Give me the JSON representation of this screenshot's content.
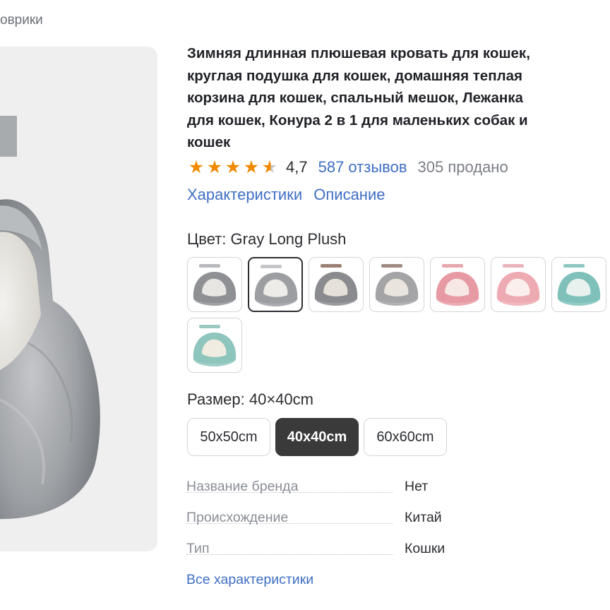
{
  "breadcrumb": "оврики",
  "product": {
    "title_lines": [
      "Зимняя длинная плюшевая кровать для кошек,",
      "круглая подушка для кошек, домашняя теплая",
      "корзина для кошек, спальный мешок, Лежанка",
      "для кошек, Конура 2 в 1 для маленьких собак и",
      "кошек"
    ],
    "rating": "4,7",
    "rating_stars": 4.5,
    "reviews": "587 отзывов",
    "sold": "305 продано"
  },
  "tabs": [
    "Характеристики",
    "Описание"
  ],
  "color": {
    "label": "Цвет:",
    "value": "Gray Long Plush",
    "swatches": [
      {
        "bed": "#8e9094",
        "inner": "#e8e6e2",
        "tag": "#b7b9bc",
        "selected": false
      },
      {
        "bed": "#9c9ea2",
        "inner": "#eeece8",
        "tag": "#c4c6c9",
        "selected": true
      },
      {
        "bed": "#8a8b8e",
        "inner": "#e6e1d8",
        "tag": "#9a7f72",
        "selected": false
      },
      {
        "bed": "#a4a4a6",
        "inner": "#e9e5de",
        "tag": "#a08a80",
        "selected": false
      },
      {
        "bed": "#e79aa4",
        "inner": "#f7e8e6",
        "tag": "#e7a7ae",
        "selected": false
      },
      {
        "bed": "#eeaab3",
        "inner": "#fbefed",
        "tag": "#eab3ba",
        "selected": false
      },
      {
        "bed": "#7fc1ba",
        "inner": "#e8f1ee",
        "tag": "#8fc8c1",
        "selected": false
      },
      {
        "bed": "#8ec5bd",
        "inner": "#f1ece2",
        "tag": "#9bcac3",
        "selected": false
      }
    ]
  },
  "size": {
    "label": "Размер:",
    "value": "40×40cm",
    "options": [
      "50x50cm",
      "40x40cm",
      "60x60cm"
    ],
    "selected_index": 1
  },
  "specs": [
    {
      "key": "Название бренда",
      "value": "Нет"
    },
    {
      "key": "Происхождение",
      "value": "Китай"
    },
    {
      "key": "Тип",
      "value": "Кошки"
    }
  ],
  "all_specs_link": "Все характеристики",
  "colors": {
    "link": "#3f6fc4",
    "star": "#f28a00",
    "selected_bg": "#3a3a3a"
  }
}
